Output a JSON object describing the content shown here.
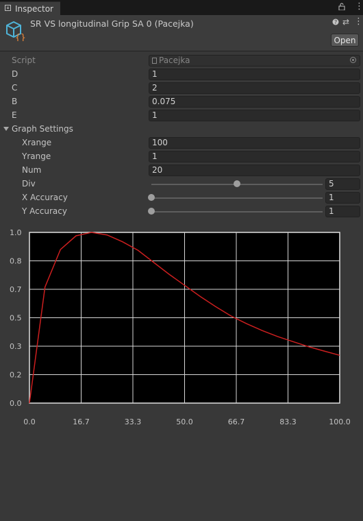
{
  "tab": {
    "title": "Inspector",
    "icon": "inspector-tab-icon"
  },
  "header": {
    "title": "SR VS longitudinal Grip SA 0 (Pacejka)",
    "open_label": "Open",
    "icon": "scriptable-object-icon"
  },
  "fields": {
    "script": {
      "label": "Script",
      "value": "Pacejka"
    },
    "d": {
      "label": "D",
      "value": "1"
    },
    "c": {
      "label": "C",
      "value": "2"
    },
    "b": {
      "label": "B",
      "value": "0.075"
    },
    "e": {
      "label": "E",
      "value": "1"
    }
  },
  "graph_settings": {
    "label": "Graph Settings",
    "xrange": {
      "label": "Xrange",
      "value": "100"
    },
    "yrange": {
      "label": "Yrange",
      "value": "1"
    },
    "num": {
      "label": "Num",
      "value": "20"
    },
    "div": {
      "label": "Div",
      "value": "5",
      "slider_fraction": 0.5
    },
    "x_accuracy": {
      "label": "X Accuracy",
      "value": "1",
      "slider_fraction": 0.0
    },
    "y_accuracy": {
      "label": "Y Accuracy",
      "value": "1",
      "slider_fraction": 0.0
    }
  },
  "colors": {
    "curve": "#cc1f1f",
    "plot_bg": "#000000",
    "grid": "#d8d8d8"
  },
  "chart_data": {
    "type": "line",
    "title": "",
    "xlabel": "",
    "ylabel": "",
    "xlim": [
      0,
      100
    ],
    "ylim": [
      0,
      1
    ],
    "x_ticks": [
      "0.0",
      "16.7",
      "33.3",
      "50.0",
      "66.7",
      "83.3",
      "100.0"
    ],
    "y_ticks": [
      "0.0",
      "0.2",
      "0.3",
      "0.5",
      "0.7",
      "0.8",
      "1.0"
    ],
    "grid": true,
    "series": [
      {
        "x": [
          0,
          5,
          10,
          15,
          20,
          25,
          30,
          35,
          40,
          45,
          50,
          55,
          60,
          65,
          70,
          75,
          80,
          85,
          90,
          95,
          100
        ],
        "y": [
          0,
          0.68,
          0.9,
          0.98,
          1.0,
          0.985,
          0.945,
          0.895,
          0.825,
          0.755,
          0.69,
          0.625,
          0.565,
          0.51,
          0.465,
          0.425,
          0.39,
          0.36,
          0.33,
          0.305,
          0.28
        ]
      }
    ]
  }
}
